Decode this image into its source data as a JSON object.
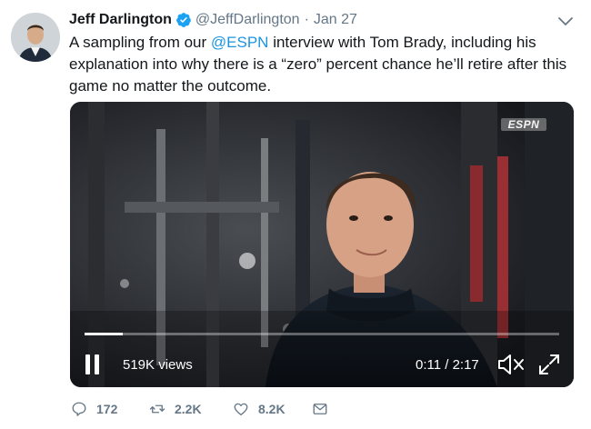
{
  "tweet": {
    "author_name": "Jeff Darlington",
    "handle": "@JeffDarlington",
    "separator": "·",
    "date": "Jan 27",
    "text_before": "A sampling from our ",
    "mention": "@ESPN",
    "text_after": " interview with Tom Brady, including his explanation into why there is a “zero” percent chance he’ll retire after this game no matter the outcome."
  },
  "video": {
    "watermark": "ESPN",
    "views": "519K views",
    "time": "0:11 / 2:17",
    "progress": 0.08
  },
  "actions": {
    "replies": "172",
    "retweets": "2.2K",
    "likes": "8.2K"
  },
  "colors": {
    "link": "#1b95e0",
    "verified": "#1da1f2",
    "secondary_text": "#657786"
  },
  "icons": [
    "verified-badge-icon",
    "chevron-down-icon",
    "pause-icon",
    "mute-icon",
    "fullscreen-icon",
    "reply-icon",
    "retweet-icon",
    "like-icon",
    "message-icon"
  ]
}
